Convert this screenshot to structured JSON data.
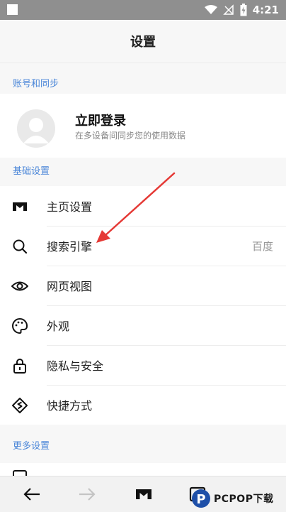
{
  "status": {
    "time": "4:21"
  },
  "header": {
    "title": "设置"
  },
  "sections": {
    "account": "账号和同步",
    "basic": "基础设置",
    "more": "更多设置"
  },
  "account": {
    "title": "立即登录",
    "subtitle": "在多设备间同步您的使用数据"
  },
  "basic_items": [
    {
      "label": "主页设置",
      "icon": "home-logo-icon"
    },
    {
      "label": "搜索引擎",
      "icon": "search-icon",
      "value": "百度"
    },
    {
      "label": "网页视图",
      "icon": "eye-icon"
    },
    {
      "label": "外观",
      "icon": "palette-icon"
    },
    {
      "label": "隐私与安全",
      "icon": "lock-icon"
    },
    {
      "label": "快捷方式",
      "icon": "shortcut-icon"
    }
  ],
  "watermark": {
    "text": "PCPOP下载"
  },
  "colors": {
    "accent": "#4a86d8",
    "annotation": "#e53935"
  }
}
